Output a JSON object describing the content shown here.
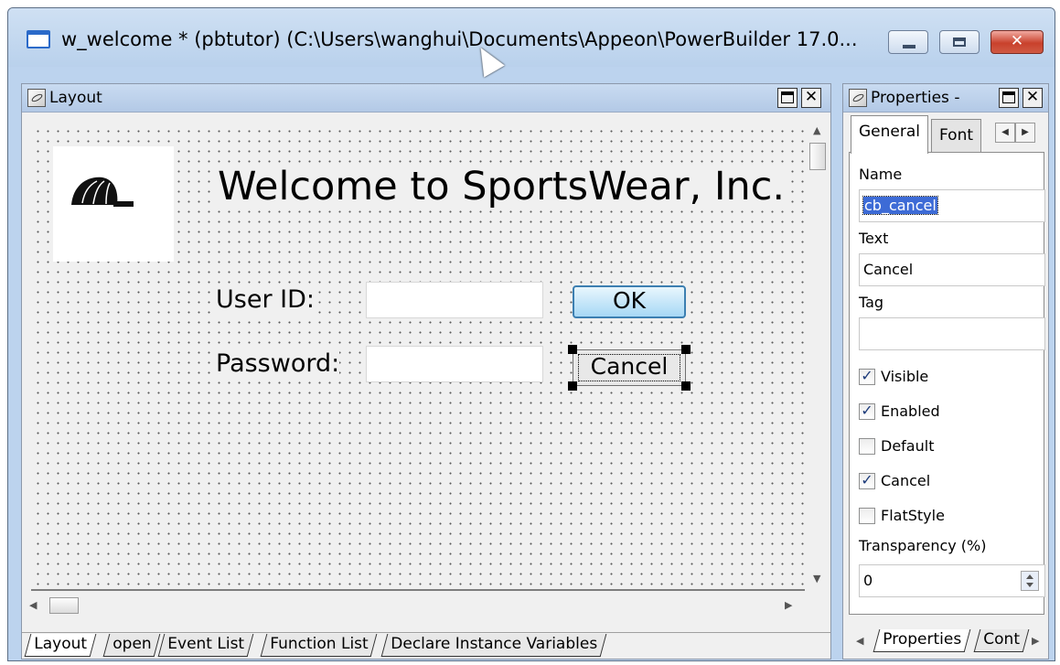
{
  "window": {
    "title": "w_welcome * (pbtutor) (C:\\Users\\wanghui\\Documents\\Appeon\\PowerBuilder 17.0..."
  },
  "layout_pane": {
    "title": "Layout",
    "welcome_text": "Welcome to SportsWear, Inc.",
    "user_label": "User ID:",
    "password_label": "Password:",
    "ok_label": "OK",
    "cancel_label": "Cancel",
    "bottom_tabs": [
      "Layout",
      "open",
      "Event List",
      "Function List",
      "Declare Instance Variables"
    ]
  },
  "properties_pane": {
    "title": "Properties -",
    "tabs": [
      "General",
      "Font"
    ],
    "name_label": "Name",
    "name_value": "cb_cancel",
    "text_label": "Text",
    "text_value": "Cancel",
    "tag_label": "Tag",
    "tag_value": "",
    "checkboxes": [
      {
        "label": "Visible",
        "checked": true
      },
      {
        "label": "Enabled",
        "checked": true
      },
      {
        "label": "Default",
        "checked": false
      },
      {
        "label": "Cancel",
        "checked": true
      },
      {
        "label": "FlatStyle",
        "checked": false
      }
    ],
    "transparency_label": "Transparency (%)",
    "transparency_value": "0",
    "bottom_tabs": [
      "Properties",
      "Cont"
    ]
  },
  "colors": {
    "title_bar": "#bcd3ee",
    "ok_button": "#a7d8f5",
    "selection": "#3d6bd6"
  }
}
